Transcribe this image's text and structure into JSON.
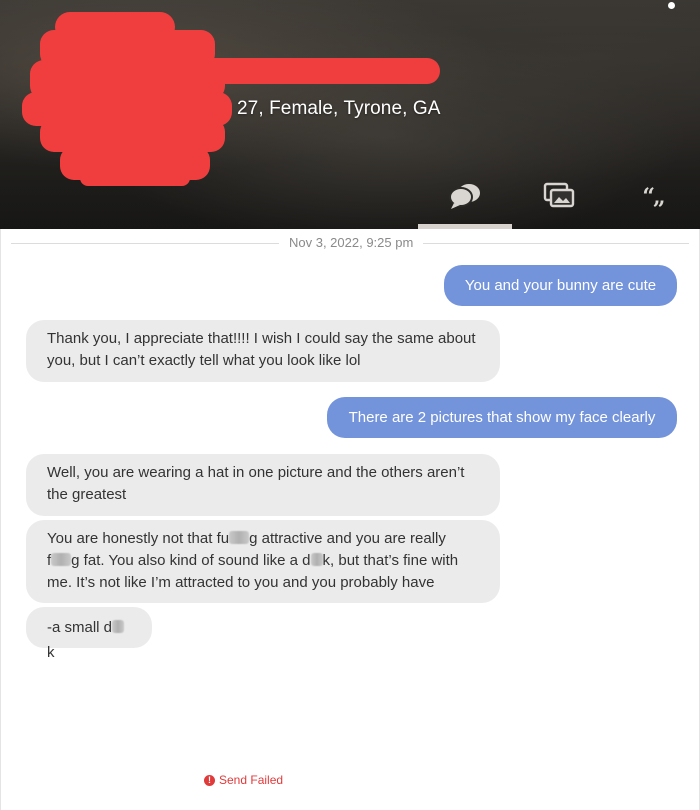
{
  "profile": {
    "info": "27, Female, Tyrone, GA"
  },
  "header": {
    "tabs": [
      {
        "name": "messages",
        "icon": "chat-bubbles-icon",
        "active": true
      },
      {
        "name": "photos",
        "icon": "photos-icon",
        "active": false
      },
      {
        "name": "quotes",
        "icon": "quotes-icon",
        "glyph": "“„",
        "active": false
      }
    ]
  },
  "chat": {
    "date": "Nov 3, 2022, 9:25 pm",
    "messages": [
      {
        "direction": "out",
        "text": "You and your bunny are cute"
      },
      {
        "direction": "in",
        "lines": [
          "Thank you, I appreciate that!!!! I wish I could say the same about",
          "you, but I can’t exactly tell what you look like lol"
        ]
      },
      {
        "direction": "out",
        "text": "There are 2 pictures that show my face clearly"
      },
      {
        "direction": "in",
        "lines": [
          "Well, you are wearing a hat in one picture and the others aren’t",
          "the greatest"
        ]
      },
      {
        "direction": "in",
        "segments": {
          "l1a": "You are honestly not that fu",
          "l1b": "g attractive and you are really",
          "l2a": "f",
          "l2b": "g fat. You also kind of sound like a d",
          "l2c": "k, but that’s fine with",
          "l3": "me. It’s not like I’m attracted to you and you probably have"
        }
      },
      {
        "direction": "in",
        "segments": {
          "a": "-a small d",
          "b": "k"
        }
      }
    ],
    "status": "Send Failed"
  },
  "colors": {
    "outgoing_bubble": "#7393db",
    "incoming_bubble": "#ebebeb",
    "redaction": "#f03e3e",
    "error": "#e03a3a"
  }
}
